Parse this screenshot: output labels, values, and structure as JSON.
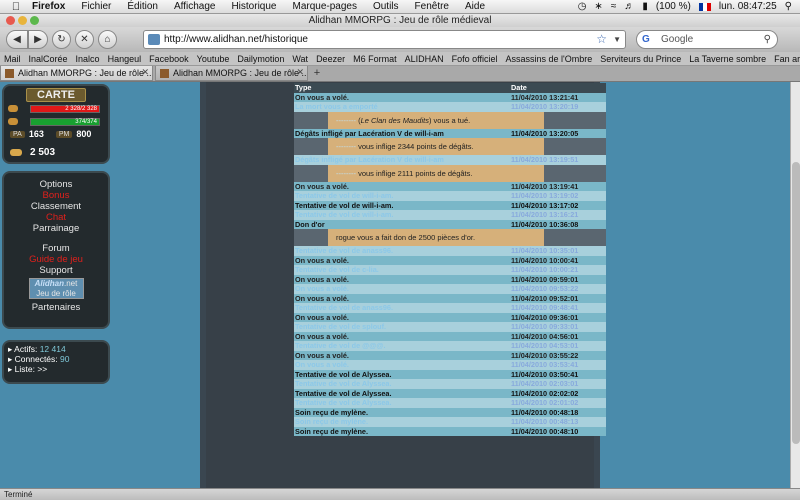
{
  "menubar": {
    "app": "Firefox",
    "items": [
      "Fichier",
      "Édition",
      "Affichage",
      "Historique",
      "Marque-pages",
      "Outils",
      "Fenêtre",
      "Aide"
    ],
    "battery": "(100 %)",
    "clock": "lun. 08:47:25"
  },
  "window": {
    "title": "Alidhan MMORPG : Jeu de rôle médieval"
  },
  "nav": {
    "url": "http://www.alidhan.net/historique",
    "search_placeholder": "Google"
  },
  "bookmarks": [
    "Mail",
    "InalCorée",
    "Inalco",
    "Hangeul",
    "Facebook",
    "Youtube",
    "Dailymotion",
    "Wat",
    "Deezer",
    "M6 Format",
    "ALIDHAN",
    "Fofo officiel",
    "Assassins de l'Ombre",
    "Serviteurs du Prince",
    "La Taverne sombre",
    "Fan art - Blog"
  ],
  "tabs": [
    {
      "label": "Alidhan MMORPG : Jeu de rôle ..."
    },
    {
      "label": "Alidhan MMORPG : Jeu de rôle ..."
    }
  ],
  "sidebar": {
    "carte": "CARTE",
    "hp": {
      "text": "2 328/2 328",
      "fraction": 1.0,
      "color": "#e01818"
    },
    "mana": {
      "text": "374/374",
      "fraction": 1.0,
      "color": "#18a030"
    },
    "pa_label": "PA",
    "pa_value": "163",
    "pm_label": "PM",
    "pm_value": "800",
    "gold": "2 503",
    "menu": {
      "options": "Options",
      "bonus": "Bonus",
      "classement": "Classement",
      "chat": "Chat",
      "parrainage": "Parrainage",
      "forum": "Forum",
      "guide": "Guide de jeu",
      "support": "Support",
      "logo_main": "Alidhan",
      "logo_net": ".net",
      "logo_sub": "Jeu de rôle",
      "partenaires": "Partenaires"
    },
    "stats": {
      "actifs_label": "Actifs:",
      "actifs_value": "12 414",
      "connectes_label": "Connectés:",
      "connectes_value": "90",
      "liste_label": "Liste: >>"
    }
  },
  "history": {
    "col_type": "Type",
    "col_date": "Date",
    "rows": [
      {
        "kind": "event",
        "style": "l",
        "type": "On vous a volé.",
        "date": "11/04/2010 13:21:41"
      },
      {
        "kind": "event",
        "style": "m",
        "type": "La mort vous a emporté",
        "date": "11/04/2010 13:20:19"
      },
      {
        "kind": "detail",
        "user": "--------",
        "text1": "(",
        "clan": "Le Clan des Maudits",
        "text2": ") vous a tué."
      },
      {
        "kind": "event",
        "style": "d",
        "type": "Dégâts infligé par Lacération V de will-i-am",
        "date": "11/04/2010 13:20:05"
      },
      {
        "kind": "detail2",
        "user": "--------",
        "text": " vous inflige 2344 points de dégâts."
      },
      {
        "kind": "event",
        "style": "m",
        "type": "Dégâts infligé par Lacération V de will-i-am",
        "date": "11/04/2010 13:19:51"
      },
      {
        "kind": "detail2",
        "user": "--------",
        "text": " vous inflige 2111 points de dégâts."
      },
      {
        "kind": "event",
        "style": "l",
        "type": "On vous a volé.",
        "date": "11/04/2010 13:19:41"
      },
      {
        "kind": "event",
        "style": "m",
        "type": "Tentative de vol de will-i-am.",
        "date": "11/04/2010 13:19:02"
      },
      {
        "kind": "event",
        "style": "d",
        "type": "Tentative de vol de will-i-am.",
        "date": "11/04/2010 13:17:02"
      },
      {
        "kind": "event",
        "style": "m",
        "type": "Tentative de vol de will-i-am.",
        "date": "11/04/2010 13:16:21"
      },
      {
        "kind": "event",
        "style": "d",
        "type": "Don d'or",
        "date": "11/04/2010 10:36:08"
      },
      {
        "kind": "detail3",
        "text": "rogue vous a fait don de 2500 pièces d'or."
      },
      {
        "kind": "event",
        "style": "m",
        "type": "Tentative de vol de anass96.",
        "date": "11/04/2010 10:35:01"
      },
      {
        "kind": "event",
        "style": "l",
        "type": "On vous a volé.",
        "date": "11/04/2010 10:00:41"
      },
      {
        "kind": "event",
        "style": "m",
        "type": "Tentative de vol de c-lia.",
        "date": "11/04/2010 10:00:21"
      },
      {
        "kind": "event",
        "style": "l",
        "type": "On vous a volé.",
        "date": "11/04/2010 09:59:01"
      },
      {
        "kind": "event",
        "style": "m",
        "type": "On vous a volé.",
        "date": "11/04/2010 09:53:22"
      },
      {
        "kind": "event",
        "style": "l",
        "type": "On vous a volé.",
        "date": "11/04/2010 09:52:01"
      },
      {
        "kind": "event",
        "style": "m",
        "type": "Tentative de vol de anass96.",
        "date": "11/04/2010 09:48:41"
      },
      {
        "kind": "event",
        "style": "l",
        "type": "On vous a volé.",
        "date": "11/04/2010 09:36:01"
      },
      {
        "kind": "event",
        "style": "m",
        "type": "Tentative de vol de splouf.",
        "date": "11/04/2010 09:33:01"
      },
      {
        "kind": "event",
        "style": "l",
        "type": "On vous a volé.",
        "date": "11/04/2010 04:56:01"
      },
      {
        "kind": "event",
        "style": "m",
        "type": "Tentative de vol de @@@.",
        "date": "11/04/2010 04:53:01"
      },
      {
        "kind": "event",
        "style": "l",
        "type": "On vous a volé.",
        "date": "11/04/2010 03:55:22"
      },
      {
        "kind": "event",
        "style": "m",
        "type": "On vous a volé.",
        "date": "11/04/2010 03:53:41"
      },
      {
        "kind": "event",
        "style": "d",
        "type": "Tentative de vol de Alyssea.",
        "date": "11/04/2010 03:50:41"
      },
      {
        "kind": "event",
        "style": "m",
        "type": "Tentative de vol de Alyssea.",
        "date": "11/04/2010 02:03:01"
      },
      {
        "kind": "event",
        "style": "d",
        "type": "Tentative de vol de Alyssea.",
        "date": "11/04/2010 02:02:02"
      },
      {
        "kind": "event",
        "style": "m",
        "type": "Tentative de vol de Alyssea.",
        "date": "11/04/2010 02:01:02"
      },
      {
        "kind": "event",
        "style": "d",
        "type": "Soin reçu de mylène.",
        "date": "11/04/2010 00:48:18"
      },
      {
        "kind": "event",
        "style": "m",
        "type": "Soin reçu de mylène.",
        "date": "11/04/2010 00:48:13"
      },
      {
        "kind": "event",
        "style": "d",
        "type": "Soin reçu de mylène.",
        "date": "11/04/2010 00:48:10"
      }
    ]
  },
  "status": {
    "text": "Terminé"
  }
}
